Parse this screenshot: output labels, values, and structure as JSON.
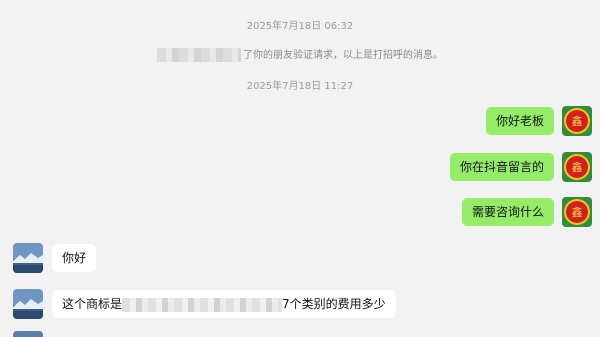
{
  "timestamps": [
    "2025年7月18日 06:32",
    "2025年7月18日 11:27"
  ],
  "system_message": "了你的朋友验证请求，以上是打招呼的消息。",
  "messages": [
    {
      "side": "right",
      "text": "你好老板"
    },
    {
      "side": "right",
      "text": "你在抖音留言的"
    },
    {
      "side": "right",
      "text": "需要咨询什么"
    },
    {
      "side": "left",
      "text": "你好"
    },
    {
      "side": "left",
      "text_start": "这个商标是",
      "text_end": "7个类别的费用多少"
    }
  ],
  "colors": {
    "background": "#f2f2f2",
    "outgoing_bubble": "#95ec69",
    "incoming_bubble": "#ffffff",
    "timestamp_text": "#9a9a9a"
  },
  "icons": {
    "self_avatar": "red-seal-logo-avatar-icon",
    "contact_avatar": "landscape-photo-avatar-icon"
  }
}
